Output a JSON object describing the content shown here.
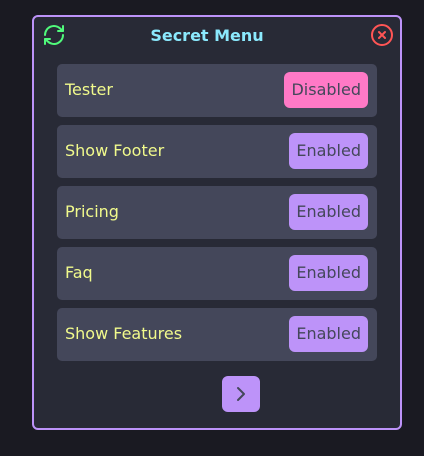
{
  "menu": {
    "title": "Secret Menu",
    "refresh_icon": "refresh-icon",
    "close_icon": "close-circle-icon",
    "next_icon": "chevron-right-icon"
  },
  "settings": [
    {
      "label": "Tester",
      "state": "Disabled"
    },
    {
      "label": "Show Footer",
      "state": "Enabled"
    },
    {
      "label": "Pricing",
      "state": "Enabled"
    },
    {
      "label": "Faq",
      "state": "Enabled"
    },
    {
      "label": "Show Features",
      "state": "Enabled"
    }
  ],
  "colors": {
    "panel_bg": "#282a36",
    "row_bg": "#44475a",
    "border": "#bd93f9",
    "title": "#8be9fd",
    "label": "#f1fa8c",
    "enabled": "#bd93f9",
    "disabled": "#ff79c6",
    "refresh_icon": "#50fa7b",
    "close_icon": "#ff5555"
  }
}
